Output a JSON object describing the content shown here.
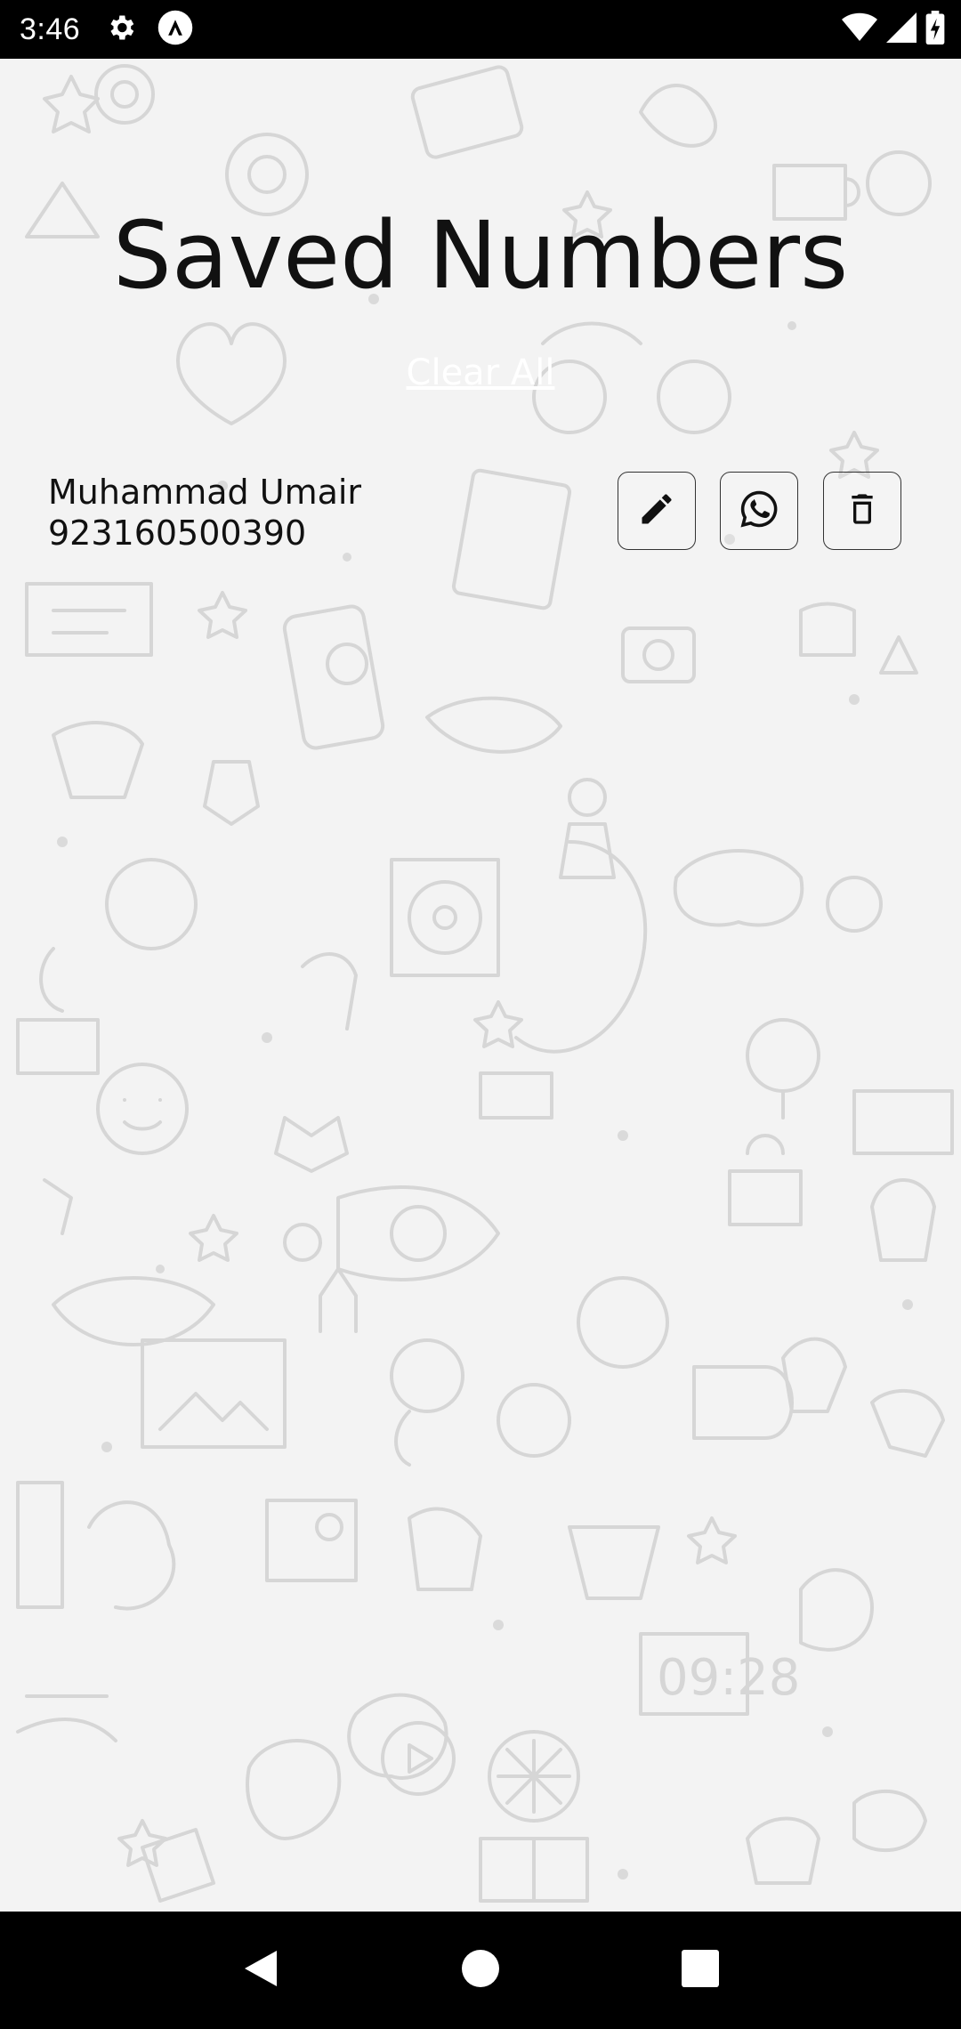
{
  "status_bar": {
    "time": "3:46",
    "left_icons": [
      "settings-icon",
      "app-notification-icon"
    ],
    "right_icons": [
      "wifi-icon",
      "cellular-signal-icon",
      "battery-icon"
    ]
  },
  "page": {
    "title": "Saved Numbers",
    "clear_all_label": "Clear All"
  },
  "saved_numbers": [
    {
      "name": "Muhammad Umair",
      "number": "923160500390",
      "actions": [
        "edit-icon",
        "whatsapp-icon",
        "delete-icon"
      ]
    }
  ],
  "nav_bar": {
    "buttons": [
      "back-icon",
      "home-icon",
      "recents-icon"
    ]
  },
  "colors": {
    "background": "#f3f3f3",
    "doodle": "#d6d6d6",
    "text": "#111111",
    "system_bars": "#000000"
  }
}
